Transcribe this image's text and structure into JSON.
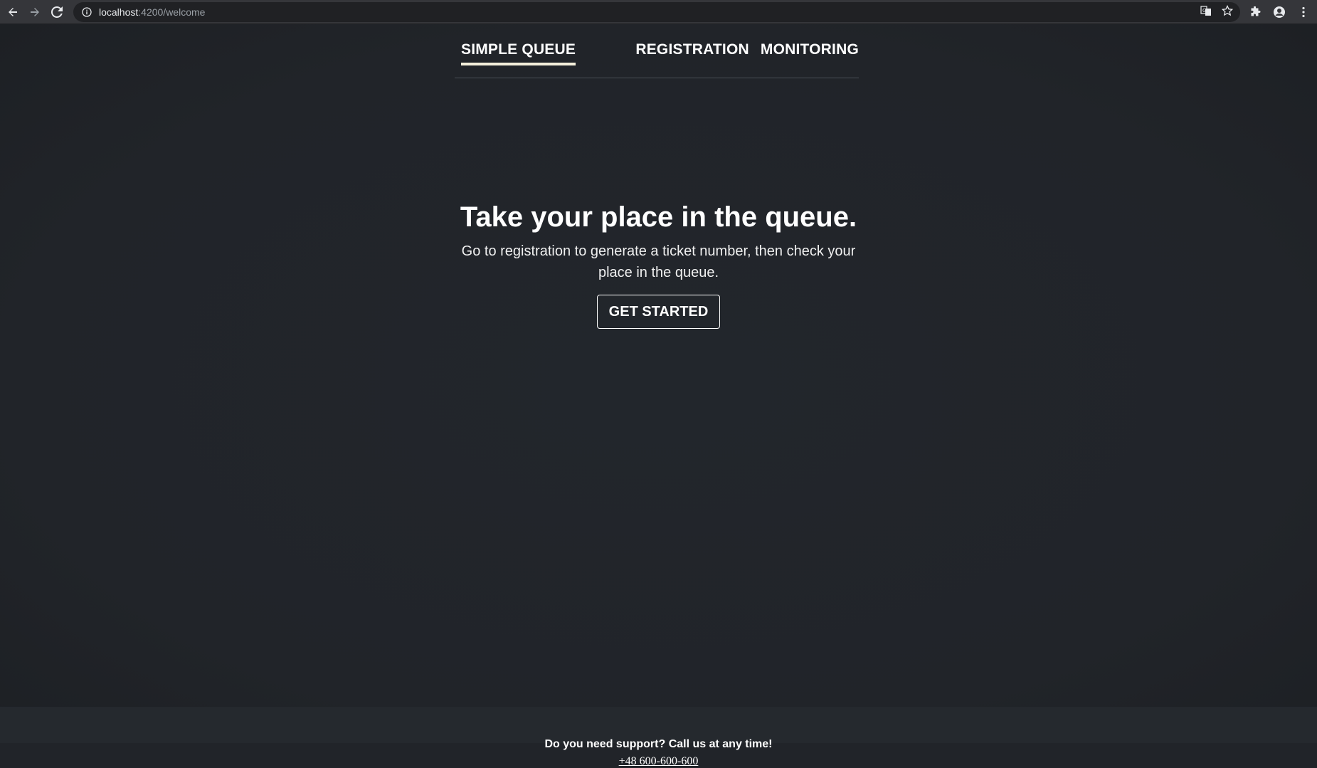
{
  "browser": {
    "url_host": "localhost",
    "url_path": ":4200/welcome"
  },
  "nav": {
    "brand": "SIMPLE QUEUE",
    "links": [
      "REGISTRATION",
      "MONITORING"
    ]
  },
  "hero": {
    "title": "Take your place in the queue.",
    "subtitle": "Go to registration to generate a ticket number, then check your place in the queue.",
    "cta_label": "GET STARTED"
  },
  "footer": {
    "support_text": "Do you need support? Call us at any time!",
    "phone": "+48 600-600-600"
  },
  "colors": {
    "background": "#212429",
    "brand_underline": "#f5f0dc",
    "text": "#ffffff"
  }
}
